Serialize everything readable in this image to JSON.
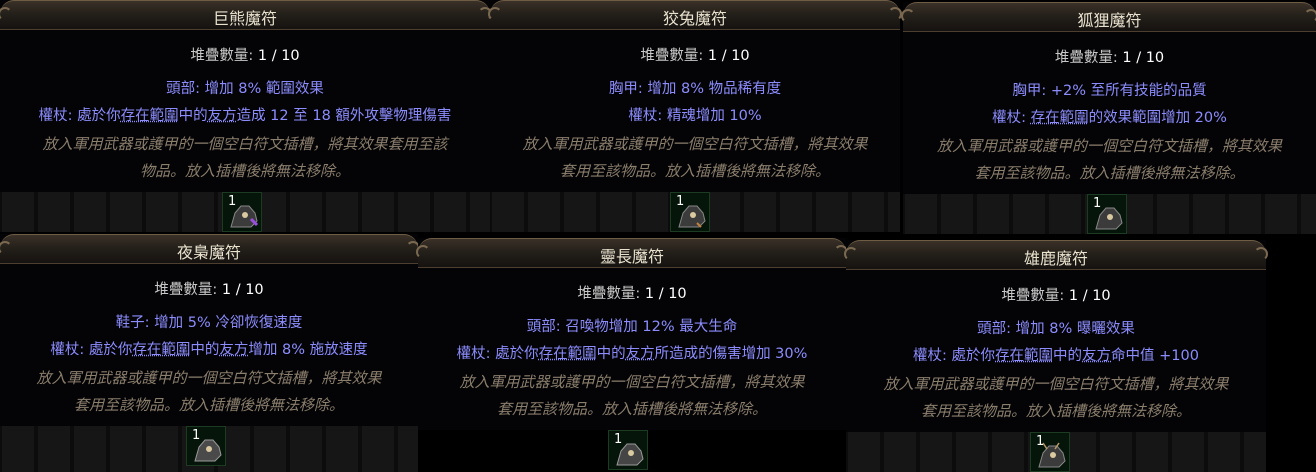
{
  "tooltips": [
    {
      "title": "巨熊魔符",
      "stack_label": "堆疊數量: ",
      "stack_value": "1 / 10",
      "mod1": "頭部: 增加 8% 範圍效果",
      "mod2_prefix": "權杖: 處於你",
      "mod2_kw1": "存在範圍",
      "mod2_mid": "中的",
      "mod2_kw2": "友方",
      "mod2_suffix": "造成 12 至 18 額外攻擊物理傷害",
      "desc_line1": "放入軍用武器或護甲的一個空白符文插槽，將其效果套用至該",
      "desc_line2": "物品。放入插槽後將無法移除。",
      "item_count": "1"
    },
    {
      "title": "狡兔魔符",
      "stack_label": "堆疊數量: ",
      "stack_value": "1 / 10",
      "mod1": "胸甲: 增加 8% 物品稀有度",
      "mod2_prefix": "權杖: 精魂增加 10%",
      "mod2_kw1": "",
      "mod2_mid": "",
      "mod2_kw2": "",
      "mod2_suffix": "",
      "desc_line1": "放入軍用武器或護甲的一個空白符文插槽，將其效果",
      "desc_line2": "套用至該物品。放入插槽後將無法移除。",
      "item_count": "1"
    },
    {
      "title": "狐狸魔符",
      "stack_label": "堆疊數量: ",
      "stack_value": "1 / 10",
      "mod1": "胸甲: +2% 至所有技能的品質",
      "mod2_prefix": "權杖: ",
      "mod2_kw1": "存在範圍",
      "mod2_mid": "",
      "mod2_kw2": "",
      "mod2_suffix": "的效果範圍增加 20%",
      "desc_line1": "放入軍用武器或護甲的一個空白符文插槽，將其效果",
      "desc_line2": "套用至該物品。放入插槽後將無法移除。",
      "item_count": "1"
    },
    {
      "title": "夜梟魔符",
      "stack_label": "堆疊數量: ",
      "stack_value": "1 / 10",
      "mod1": "鞋子: 增加 5% 冷卻恢復速度",
      "mod2_prefix": "權杖: 處於你",
      "mod2_kw1": "存在範圍",
      "mod2_mid": "中的",
      "mod2_kw2": "友方",
      "mod2_suffix": "增加 8% 施放速度",
      "desc_line1": "放入軍用武器或護甲的一個空白符文插槽，將其效果",
      "desc_line2": "套用至該物品。放入插槽後將無法移除。",
      "item_count": "1"
    },
    {
      "title": "靈長魔符",
      "stack_label": "堆疊數量: ",
      "stack_value": "1 / 10",
      "mod1": "頭部: 召喚物增加 12% 最大生命",
      "mod2_prefix": "權杖: 處於你",
      "mod2_kw1": "存在範圍",
      "mod2_mid": "中的",
      "mod2_kw2": "友方",
      "mod2_suffix": "所造成的傷害增加 30%",
      "desc_line1": "放入軍用武器或護甲的一個空白符文插槽，將其效果",
      "desc_line2": "套用至該物品。放入插槽後將無法移除。",
      "item_count": "1"
    },
    {
      "title": "雄鹿魔符",
      "stack_label": "堆疊數量: ",
      "stack_value": "1 / 10",
      "mod1": "頭部: 增加 8% 曝曬效果",
      "mod2_prefix": "權杖: 處於你",
      "mod2_kw1": "存在範圍",
      "mod2_mid": "中的",
      "mod2_kw2": "友方",
      "mod2_suffix": "命中值 +100",
      "desc_line1": "放入軍用武器或護甲的一個空白符文插槽，將其效果",
      "desc_line2": "套用至該物品。放入插槽後將無法移除。",
      "item_count": "1"
    }
  ],
  "colors": {
    "title": "#e9e2cf",
    "stack_label": "#c8c8c8",
    "mod": "#8c8cff",
    "description": "#8a7e6c"
  },
  "icons": [
    "talisman-icon"
  ]
}
